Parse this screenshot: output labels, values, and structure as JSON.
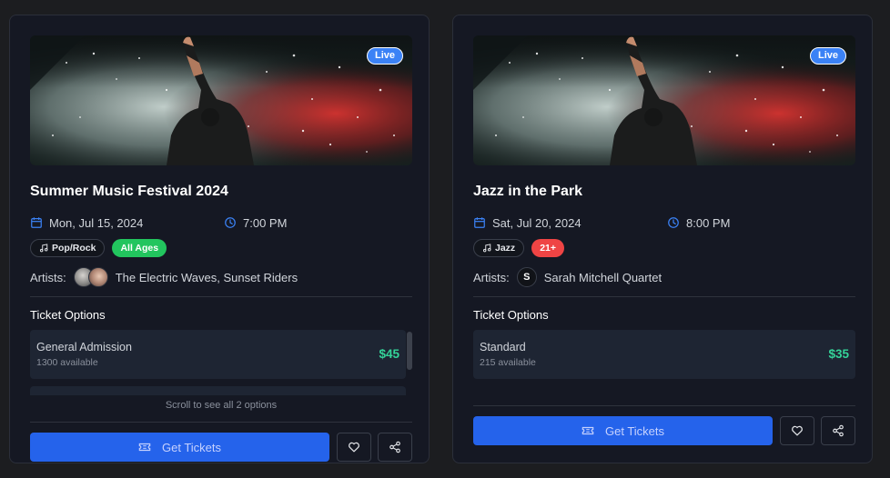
{
  "events": [
    {
      "badge": "Live",
      "title": "Summer Music Festival 2024",
      "date": "Mon, Jul 15, 2024",
      "time": "7:00 PM",
      "genre": "Pop/Rock",
      "age": "All Ages",
      "age_color": "#22c55e",
      "artists_label": "Artists:",
      "artists": "The Electric Waves, Sunset Riders",
      "ticket_options_label": "Ticket Options",
      "tickets": [
        {
          "name": "General Admission",
          "availability": "1300 available",
          "price": "$45"
        }
      ],
      "scroll_hint": "Scroll to see all 2 options",
      "get_tickets": "Get Tickets"
    },
    {
      "badge": "Live",
      "title": "Jazz in the Park",
      "date": "Sat, Jul 20, 2024",
      "time": "8:00 PM",
      "genre": "Jazz",
      "age": "21+",
      "age_color": "#ef4444",
      "artists_label": "Artists:",
      "artist_initial": "S",
      "artists": "Sarah Mitchell Quartet",
      "ticket_options_label": "Ticket Options",
      "tickets": [
        {
          "name": "Standard",
          "availability": "215 available",
          "price": "$35"
        }
      ],
      "get_tickets": "Get Tickets"
    }
  ],
  "icons": {
    "date": "calendar-icon",
    "time": "clock-icon",
    "genre": "music-note-icon",
    "ticket": "ticket-icon",
    "favorite": "heart-icon",
    "share": "share-icon"
  },
  "colors": {
    "accent": "#2563eb",
    "price": "#34d399",
    "live_badge": "#3b82f6"
  }
}
